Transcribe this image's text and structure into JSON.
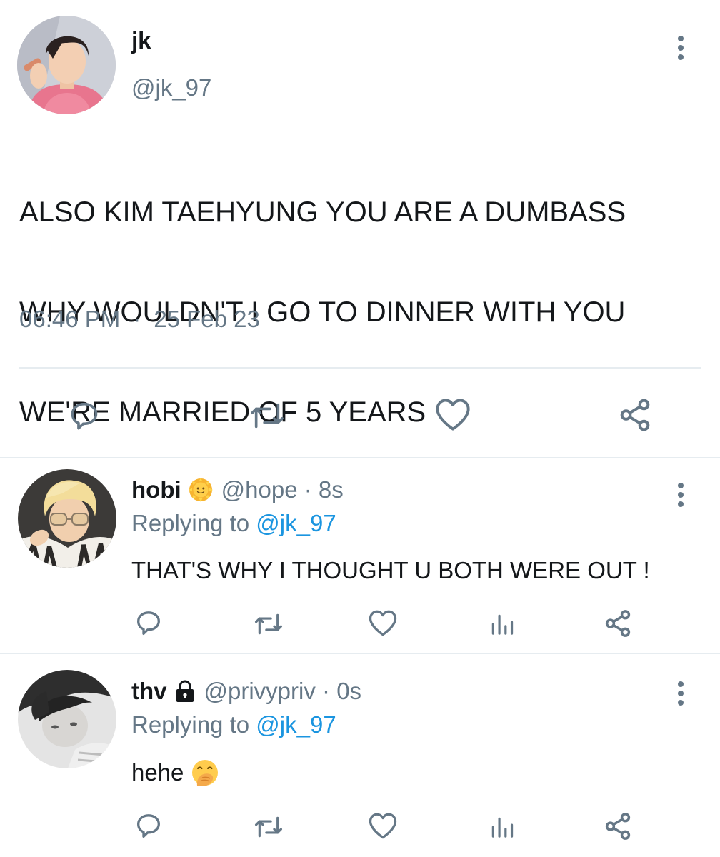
{
  "main_tweet": {
    "display_name": "jk",
    "handle": "@jk_97",
    "text_lines": [
      "ALSO KIM TAEHYUNG YOU ARE A DUMBASS",
      "WHY WOULDN'T I GO TO DINNER WITH YOU",
      "WE'RE MARRIED OF 5 YEARS"
    ],
    "time": "06:46 PM",
    "separator": "·",
    "date": "25 Feb 23",
    "actions": [
      "reply-icon",
      "retweet-icon",
      "like-icon",
      "share-icon"
    ]
  },
  "replies": [
    {
      "display_name": "hobi",
      "badge": "sun-face-emoji",
      "handle": "@hope",
      "separator": "·",
      "time": "8s",
      "replying_label": "Replying to",
      "replying_to": "@jk_97",
      "text": "THAT'S WHY I THOUGHT U BOTH WERE OUT !",
      "actions": [
        "reply-icon",
        "retweet-icon",
        "like-icon",
        "analytics-icon",
        "share-icon"
      ]
    },
    {
      "display_name": "thv",
      "badge": "lock-icon",
      "handle": "@privypriv",
      "separator": "·",
      "time": "0s",
      "replying_label": "Replying to",
      "replying_to": "@jk_97",
      "text": "hehe",
      "text_emoji": "hand-over-mouth-emoji",
      "actions": [
        "reply-icon",
        "retweet-icon",
        "like-icon",
        "analytics-icon",
        "share-icon"
      ]
    }
  ],
  "colors": {
    "text": "#14171a",
    "secondary": "#657786",
    "link": "#1b95e0",
    "divider": "#e6ecf0"
  }
}
